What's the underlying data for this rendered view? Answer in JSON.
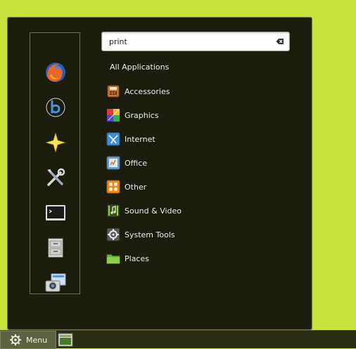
{
  "search": {
    "value": "print"
  },
  "all_applications_label": "All Applications",
  "categories": [
    {
      "label": "Accessories",
      "icon": "accessories-icon"
    },
    {
      "label": "Graphics",
      "icon": "graphics-icon"
    },
    {
      "label": "Internet",
      "icon": "internet-icon"
    },
    {
      "label": "Office",
      "icon": "office-icon"
    },
    {
      "label": "Other",
      "icon": "other-icon"
    },
    {
      "label": "Sound & Video",
      "icon": "sound-video-icon"
    },
    {
      "label": "System Tools",
      "icon": "system-tools-icon"
    },
    {
      "label": "Places",
      "icon": "places-icon"
    }
  ],
  "favorites": [
    {
      "icon": "firefox-icon"
    },
    {
      "icon": "banshee-icon"
    },
    {
      "icon": "star-icon"
    },
    {
      "icon": "tools-icon"
    },
    {
      "icon": "terminal-icon"
    },
    {
      "icon": "file-cabinet-icon"
    },
    {
      "icon": "screenshot-icon"
    }
  ],
  "taskbar": {
    "menu_label": "Menu"
  },
  "colors": {
    "desktop": "#c8e33e",
    "menu_bg": "#1c1c0c",
    "taskbar": "#2a2c14"
  }
}
